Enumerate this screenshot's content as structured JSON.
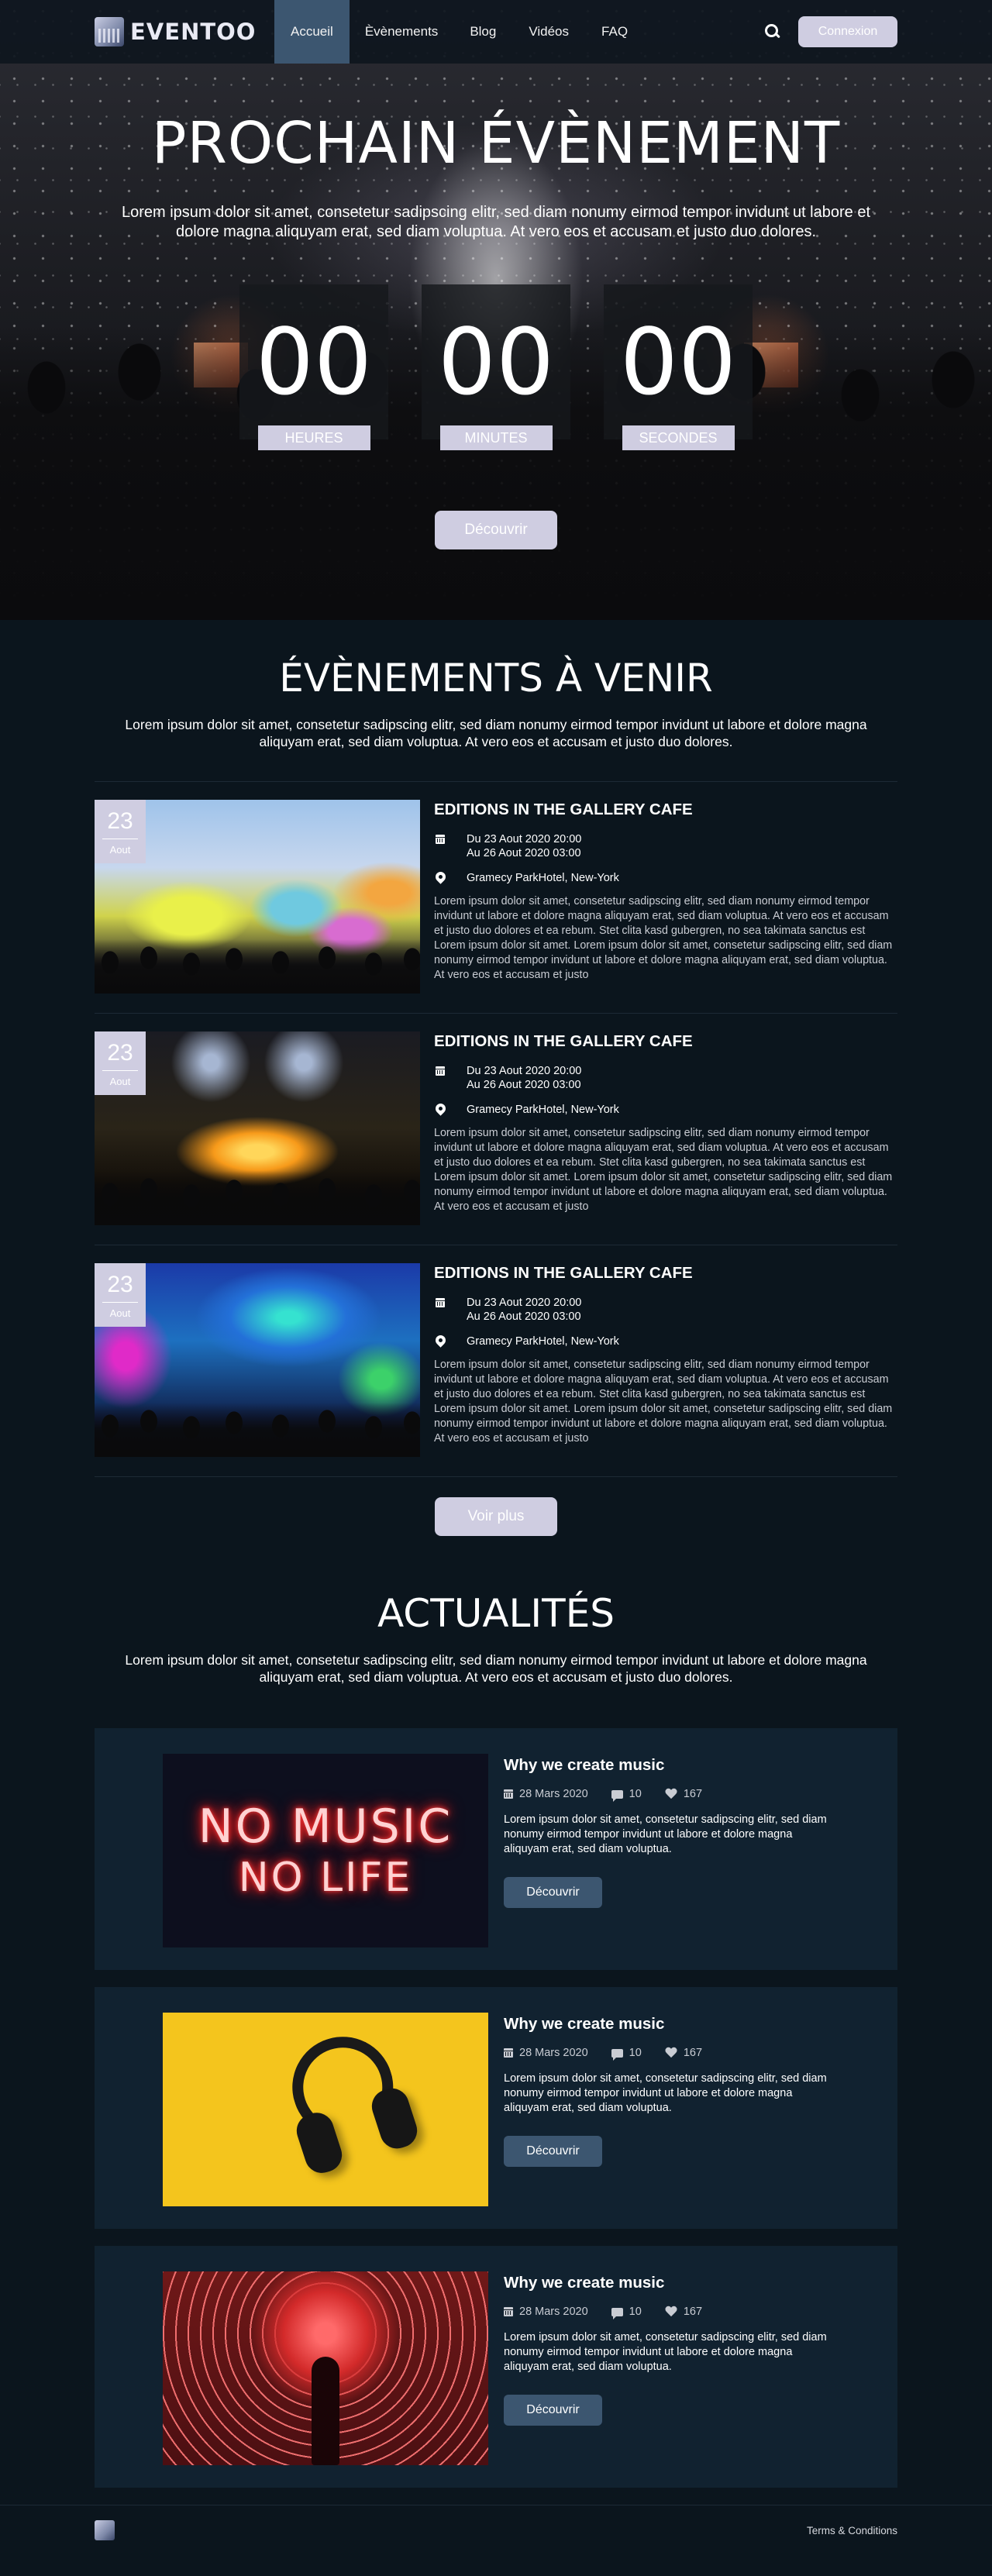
{
  "nav": {
    "logo_text": "EVENTOO",
    "links": [
      "Accueil",
      "Èvènements",
      "Blog",
      "Vidéos",
      "FAQ"
    ],
    "active_index": 0,
    "login_label": "Connexion"
  },
  "hero": {
    "title": "PROCHAIN ÉVÈNEMENT",
    "text": "Lorem ipsum dolor sit amet, consetetur sadipscing elitr, sed diam nonumy eirmod tempor invidunt ut labore et dolore magna aliquyam erat, sed diam voluptua. At vero eos et accusam et justo duo dolores.",
    "countdown": [
      {
        "value": "00",
        "label": "HEURES"
      },
      {
        "value": "00",
        "label": "MINUTES"
      },
      {
        "value": "00",
        "label": "SECONDES"
      }
    ],
    "button_label": "Découvrir"
  },
  "events": {
    "title": "ÉVÈNEMENTS À VENIR",
    "text": "Lorem ipsum dolor sit amet, consetetur sadipscing elitr, sed diam nonumy eirmod tempor invidunt ut labore et dolore magna aliquyam erat, sed diam voluptua. At vero eos et accusam et justo duo dolores.",
    "items": [
      {
        "day": "23",
        "month": "Aout",
        "title": "EDITIONS IN THE GALLERY CAFE",
        "date_start": "Du 23 Aout 2020 20:00",
        "date_end": "Au 26 Aout 2020 03:00",
        "location": "Gramecy ParkHotel, New-York",
        "description": "Lorem ipsum dolor sit amet, consetetur sadipscing elitr, sed diam nonumy eirmod tempor invidunt ut labore et dolore magna aliquyam erat, sed diam voluptua. At vero eos et accusam et justo duo dolores et ea rebum. Stet clita kasd gubergren, no sea takimata sanctus est Lorem ipsum dolor sit amet. Lorem ipsum dolor sit amet, consetetur sadipscing elitr, sed diam nonumy eirmod tempor invidunt ut labore et dolore magna aliquyam erat, sed diam voluptua. At vero eos et accusam et justo"
      },
      {
        "day": "23",
        "month": "Aout",
        "title": "EDITIONS IN THE GALLERY CAFE",
        "date_start": "Du 23 Aout 2020 20:00",
        "date_end": "Au 26 Aout 2020 03:00",
        "location": "Gramecy ParkHotel, New-York",
        "description": "Lorem ipsum dolor sit amet, consetetur sadipscing elitr, sed diam nonumy eirmod tempor invidunt ut labore et dolore magna aliquyam erat, sed diam voluptua. At vero eos et accusam et justo duo dolores et ea rebum. Stet clita kasd gubergren, no sea takimata sanctus est Lorem ipsum dolor sit amet. Lorem ipsum dolor sit amet, consetetur sadipscing elitr, sed diam nonumy eirmod tempor invidunt ut labore et dolore magna aliquyam erat, sed diam voluptua. At vero eos et accusam et justo"
      },
      {
        "day": "23",
        "month": "Aout",
        "title": "EDITIONS IN THE GALLERY CAFE",
        "date_start": "Du 23 Aout 2020 20:00",
        "date_end": "Au 26 Aout 2020 03:00",
        "location": "Gramecy ParkHotel, New-York",
        "description": "Lorem ipsum dolor sit amet, consetetur sadipscing elitr, sed diam nonumy eirmod tempor invidunt ut labore et dolore magna aliquyam erat, sed diam voluptua. At vero eos et accusam et justo duo dolores et ea rebum. Stet clita kasd gubergren, no sea takimata sanctus est Lorem ipsum dolor sit amet. Lorem ipsum dolor sit amet, consetetur sadipscing elitr, sed diam nonumy eirmod tempor invidunt ut labore et dolore magna aliquyam erat, sed diam voluptua. At vero eos et accusam et justo"
      }
    ],
    "more_label": "Voir plus"
  },
  "news": {
    "title": "ACTUALITÉS",
    "text": "Lorem ipsum dolor sit amet, consetetur sadipscing elitr, sed diam nonumy eirmod tempor invidunt ut labore et dolore magna aliquyam erat, sed diam voluptua. At vero eos et accusam et justo duo dolores.",
    "items": [
      {
        "image_line1": "NO MUSIC",
        "image_line2": "NO LIFE",
        "title": "Why we create music",
        "date": "28 Mars 2020",
        "comments": "10",
        "likes": "167",
        "text": "Lorem ipsum dolor sit amet, consetetur sadipscing elitr, sed diam nonumy eirmod tempor invidunt ut labore et dolore magna aliquyam erat, sed diam voluptua.",
        "button_label": "Découvrir"
      },
      {
        "title": "Why we create music",
        "date": "28 Mars 2020",
        "comments": "10",
        "likes": "167",
        "text": "Lorem ipsum dolor sit amet, consetetur sadipscing elitr, sed diam nonumy eirmod tempor invidunt ut labore et dolore magna aliquyam erat, sed diam voluptua.",
        "button_label": "Découvrir"
      },
      {
        "title": "Why we create music",
        "date": "28 Mars 2020",
        "comments": "10",
        "likes": "167",
        "text": "Lorem ipsum dolor sit amet, consetetur sadipscing elitr, sed diam nonumy eirmod tempor invidunt ut labore et dolore magna aliquyam erat, sed diam voluptua.",
        "button_label": "Découvrir"
      }
    ]
  },
  "footer": {
    "link": "Terms & Conditions"
  },
  "colors": {
    "background": "#0b151d",
    "accent": "#cfcde1",
    "nav_active": "#3c5670",
    "card_bg": "#112230"
  }
}
